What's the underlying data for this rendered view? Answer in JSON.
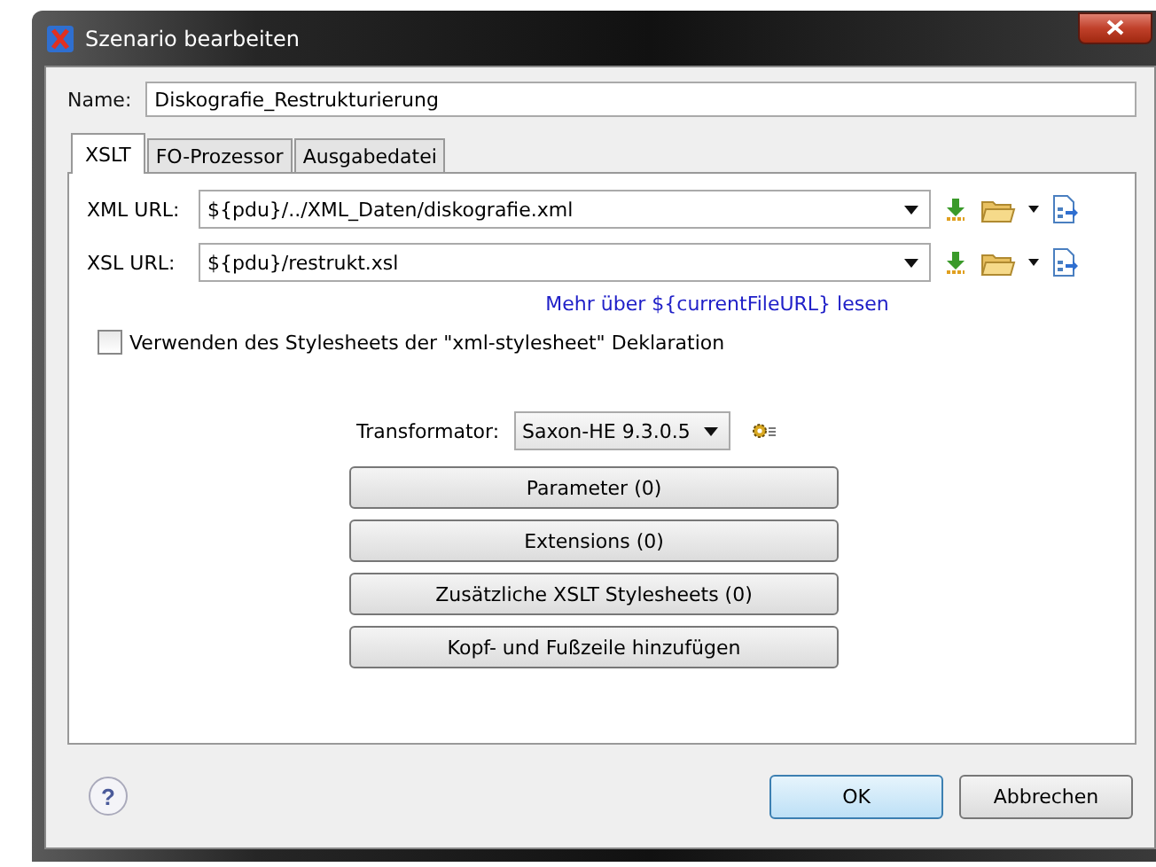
{
  "window": {
    "title": "Szenario bearbeiten"
  },
  "name": {
    "label": "Name:",
    "value": "Diskografie_Restrukturierung"
  },
  "tabs": [
    {
      "label": "XSLT",
      "selected": true
    },
    {
      "label": "FO-Prozessor",
      "selected": false
    },
    {
      "label": "Ausgabedatei",
      "selected": false
    }
  ],
  "urls": [
    {
      "label": "XML URL:",
      "value": "${pdu}/../XML_Daten/diskografie.xml"
    },
    {
      "label": "XSL URL:",
      "value": "${pdu}/restrukt.xsl"
    }
  ],
  "info_link": "Mehr über ${currentFileURL} lesen",
  "stylesheet_checkbox": {
    "label": "Verwenden des Stylesheets der \"xml-stylesheet\" Deklaration",
    "checked": false
  },
  "transformer": {
    "label": "Transformator:",
    "value": "Saxon-HE 9.3.0.5"
  },
  "buttons": [
    "Parameter (0)",
    "Extensions (0)",
    "Zusätzliche XSLT Stylesheets (0)",
    "Kopf- und Fußzeile hinzufügen"
  ],
  "help": "?",
  "footer_buttons": [
    {
      "label": "OK",
      "kind": "default"
    },
    {
      "label": "Abbrechen",
      "kind": "normal"
    }
  ]
}
